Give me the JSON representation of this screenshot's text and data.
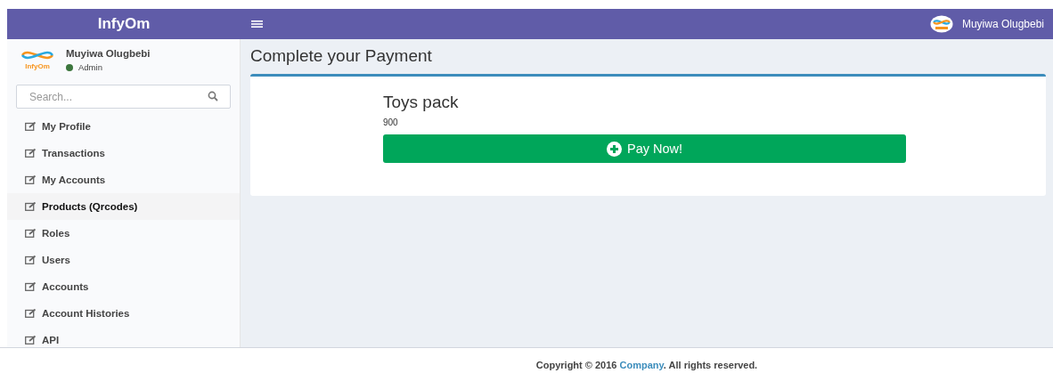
{
  "header": {
    "brand": "InfyOm",
    "user_name": "Muyiwa Olugbebi"
  },
  "sidebar": {
    "logo_text": "InfyOm",
    "user_name": "Muyiwa Olugbebi",
    "status": {
      "label": "Admin",
      "color": "#3c763d"
    },
    "search": {
      "placeholder": "Search..."
    },
    "items": [
      {
        "label": "My Profile",
        "selected": false
      },
      {
        "label": "Transactions",
        "selected": false
      },
      {
        "label": "My Accounts",
        "selected": false
      },
      {
        "label": "Products (Qrcodes)",
        "selected": true
      },
      {
        "label": "Roles",
        "selected": false
      },
      {
        "label": "Users",
        "selected": false
      },
      {
        "label": "Accounts",
        "selected": false
      },
      {
        "label": "Account Histories",
        "selected": false
      },
      {
        "label": "API",
        "selected": false
      }
    ]
  },
  "page_title": "Complete your Payment",
  "product": {
    "name": "Toys pack",
    "price": "900",
    "button": "Pay Now!"
  },
  "footer": {
    "prefix": "Copyright © 2016",
    "link": "Company",
    "suffix": ". All rights reserved."
  }
}
